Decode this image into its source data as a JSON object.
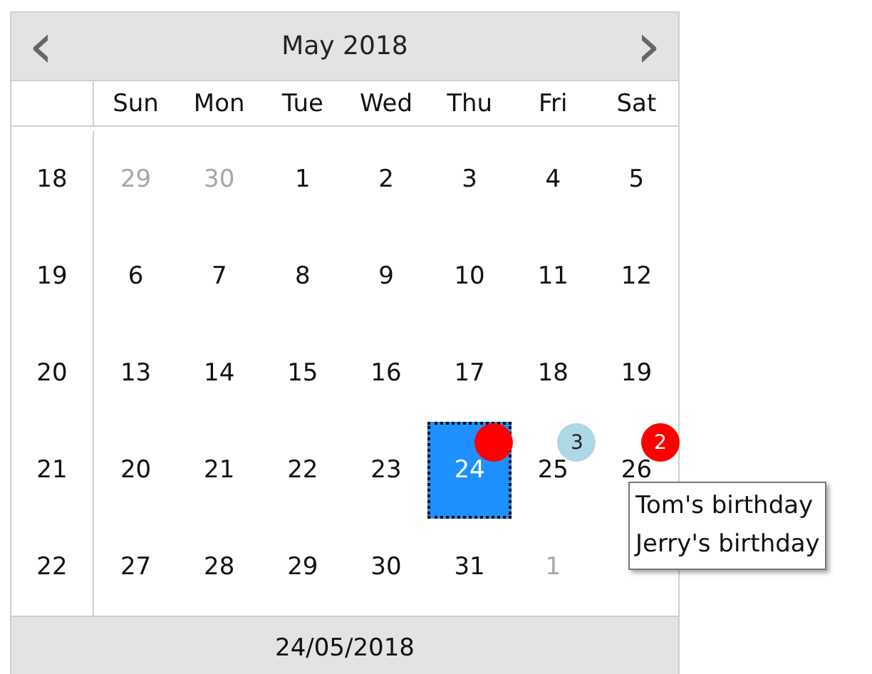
{
  "header": {
    "prev": "‹",
    "title": "May 2018",
    "next": "›"
  },
  "weekdays": [
    "Sun",
    "Mon",
    "Tue",
    "Wed",
    "Thu",
    "Fri",
    "Sat"
  ],
  "weeks": [
    {
      "week": "18",
      "days": [
        {
          "label": "29",
          "muted": true,
          "selected": false
        },
        {
          "label": "30",
          "muted": true,
          "selected": false
        },
        {
          "label": "1",
          "muted": false,
          "selected": false
        },
        {
          "label": "2",
          "muted": false,
          "selected": false
        },
        {
          "label": "3",
          "muted": false,
          "selected": false
        },
        {
          "label": "4",
          "muted": false,
          "selected": false
        },
        {
          "label": "5",
          "muted": false,
          "selected": false
        }
      ]
    },
    {
      "week": "19",
      "days": [
        {
          "label": "6",
          "muted": false,
          "selected": false
        },
        {
          "label": "7",
          "muted": false,
          "selected": false
        },
        {
          "label": "8",
          "muted": false,
          "selected": false
        },
        {
          "label": "9",
          "muted": false,
          "selected": false
        },
        {
          "label": "10",
          "muted": false,
          "selected": false
        },
        {
          "label": "11",
          "muted": false,
          "selected": false
        },
        {
          "label": "12",
          "muted": false,
          "selected": false
        }
      ]
    },
    {
      "week": "20",
      "days": [
        {
          "label": "13",
          "muted": false,
          "selected": false
        },
        {
          "label": "14",
          "muted": false,
          "selected": false
        },
        {
          "label": "15",
          "muted": false,
          "selected": false
        },
        {
          "label": "16",
          "muted": false,
          "selected": false
        },
        {
          "label": "17",
          "muted": false,
          "selected": false
        },
        {
          "label": "18",
          "muted": false,
          "selected": false
        },
        {
          "label": "19",
          "muted": false,
          "selected": false
        }
      ]
    },
    {
      "week": "21",
      "days": [
        {
          "label": "20",
          "muted": false,
          "selected": false
        },
        {
          "label": "21",
          "muted": false,
          "selected": false
        },
        {
          "label": "22",
          "muted": false,
          "selected": false
        },
        {
          "label": "23",
          "muted": false,
          "selected": false
        },
        {
          "label": "24",
          "muted": false,
          "selected": true,
          "badge": {
            "color": "#ff0000"
          }
        },
        {
          "label": "25",
          "muted": false,
          "selected": false,
          "badge": {
            "count": "3",
            "color": "#add8e6"
          }
        },
        {
          "label": "26",
          "muted": false,
          "selected": false,
          "badge": {
            "count": "2",
            "color": "#ff0000"
          }
        }
      ]
    },
    {
      "week": "22",
      "days": [
        {
          "label": "27",
          "muted": false,
          "selected": false
        },
        {
          "label": "28",
          "muted": false,
          "selected": false
        },
        {
          "label": "29",
          "muted": false,
          "selected": false
        },
        {
          "label": "30",
          "muted": false,
          "selected": false
        },
        {
          "label": "31",
          "muted": false,
          "selected": false
        },
        {
          "label": "1",
          "muted": true,
          "selected": false
        }
      ]
    }
  ],
  "footer": "24/05/2018",
  "tooltip": {
    "lines": [
      "Tom's birthday",
      "Jerry's birthday"
    ]
  }
}
